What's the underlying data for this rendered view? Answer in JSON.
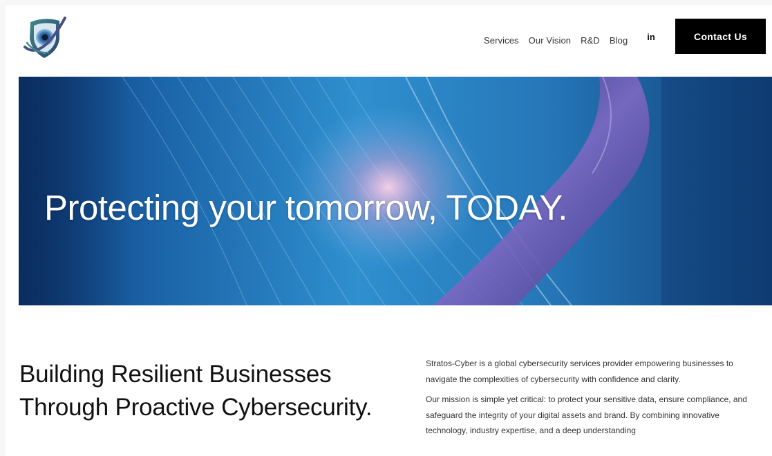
{
  "header": {
    "logo_icon": "shield-eye-logo",
    "nav": [
      {
        "label": "Services"
      },
      {
        "label": "Our Vision"
      },
      {
        "label": "R&D"
      },
      {
        "label": "Blog"
      }
    ],
    "social_label": "in",
    "social_icon": "linkedin-icon",
    "cta_label": "Contact Us"
  },
  "hero": {
    "title": "Protecting your tomorrow, TODAY."
  },
  "intro": {
    "headline": "Building Resilient Businesses Through Proactive Cybersecurity.",
    "paragraphs": [
      "Stratos-Cyber is a global cybersecurity services provider empowering businesses to navigate the complexities of cybersecurity with confidence and clarity.",
      "Our mission is simple yet critical: to protect your sensitive data, ensure compliance, and safeguard the integrity of your digital assets and brand. By combining innovative technology, industry expertise, and a deep understanding"
    ]
  },
  "colors": {
    "cta_background": "#000000",
    "hero_blue": "#1a6aa6",
    "hero_purple": "#5b4fa8"
  }
}
